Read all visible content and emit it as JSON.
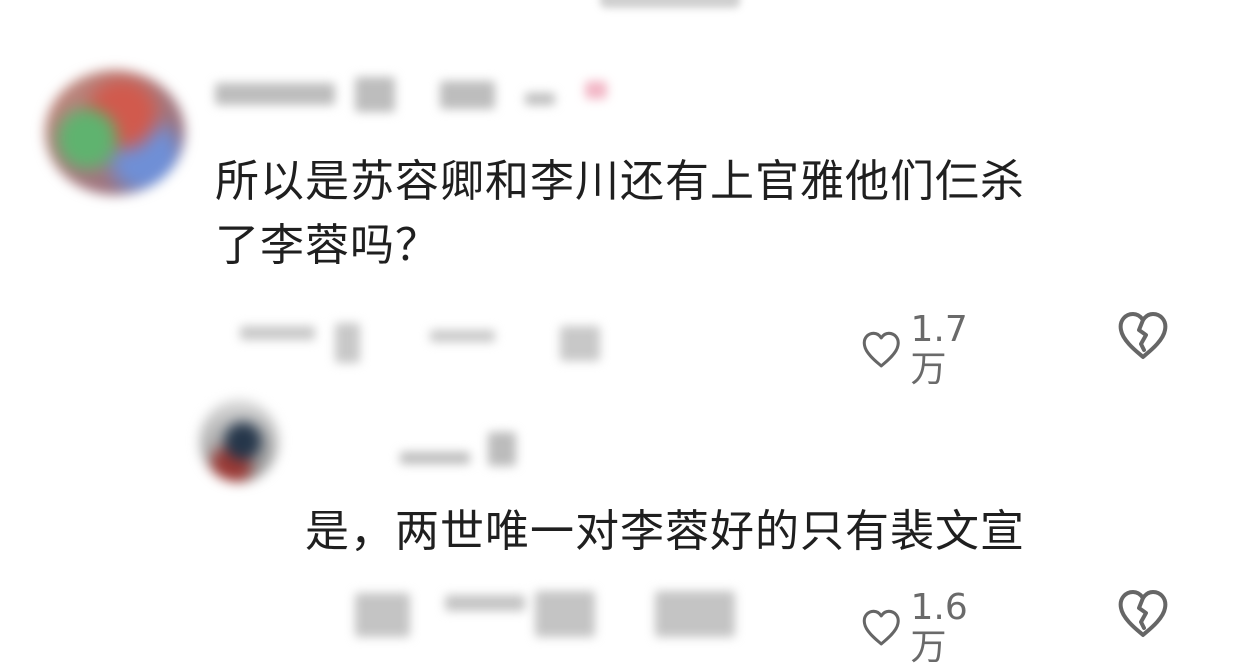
{
  "comments": {
    "main": {
      "text": "所以是苏容卿和李川还有上官雅他们仨杀\n了李蓉吗？",
      "likes": "1.7万",
      "like_icon": "heart-outline",
      "dislike_icon": "broken-heart-outline"
    },
    "reply": {
      "text": "是，两世唯一对李蓉好的只有裴文宣",
      "likes": "1.6万",
      "like_icon": "heart-outline",
      "dislike_icon": "broken-heart-outline"
    }
  }
}
